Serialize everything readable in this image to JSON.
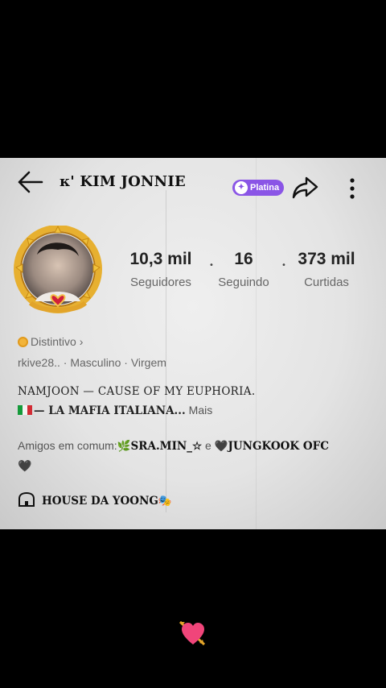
{
  "header": {
    "title": "ᴋ' KIM JONNIE",
    "badge_label": "Platina"
  },
  "stats": [
    {
      "value": "10,3 mil",
      "label": "Seguidores"
    },
    {
      "value": "16",
      "label": "Seguindo"
    },
    {
      "value": "373 mil",
      "label": "Curtidas"
    }
  ],
  "profile": {
    "distintivo": "Distintivo",
    "distintivo_chevron": "›",
    "meta": "rkive28.. · Masculino · Virgem",
    "bio_line1": "NAMJOON — CAUSE OF MY EUPHORIA.",
    "bio_line2": "— LA MAFIA ITALIANA...",
    "more_label": "Mais",
    "amigos_prefix": "Amigos em comum:",
    "amigos_friend1": "🌿SRA.MIN_☆",
    "amigos_and": "e",
    "amigos_friend2": "🖤JUNGKOOK OFC",
    "amigos_tail": "🖤",
    "house": "HOUSE DA YOONG🎭"
  },
  "colors": {
    "badge": "#8a55e6",
    "frame_gold": "#e2a42a",
    "background": "#000000"
  },
  "icons": {
    "back": "arrow-left-icon",
    "share": "share-icon",
    "more": "more-vertical-icon",
    "house": "house-icon",
    "heart": "heart-arrow-icon"
  }
}
